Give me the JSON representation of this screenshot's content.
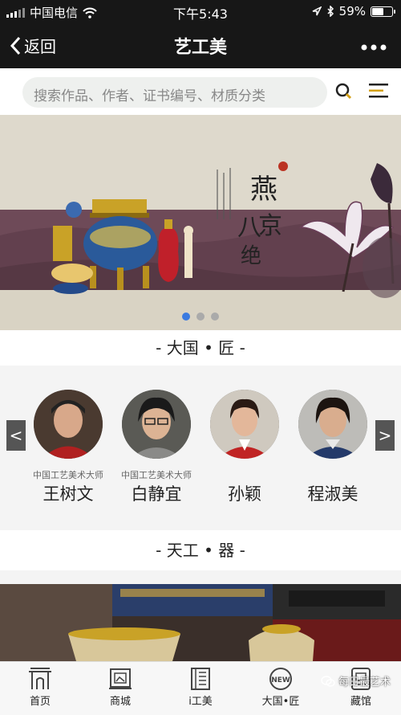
{
  "status": {
    "carrier": "中国电信",
    "time": "下午5:43",
    "battery": "59%",
    "battery_fraction": 0.59
  },
  "nav": {
    "back": "返回",
    "title": "艺工美"
  },
  "search": {
    "placeholder": "搜索作品、作者、证书编号、材质分类"
  },
  "banner": {
    "calligraphy": "燕京八绝",
    "slides": 3,
    "active_slide": 1
  },
  "sections": {
    "first": "- 大国 • 匠 -",
    "second": "- 天工 • 器 -"
  },
  "artists": [
    {
      "role": "中国工艺美术大师",
      "name": "王树文"
    },
    {
      "role": "中国工艺美术大师",
      "name": "白静宜"
    },
    {
      "role": "",
      "name": "孙颖"
    },
    {
      "role": "",
      "name": "程淑美"
    }
  ],
  "arrows": {
    "prev": "<",
    "next": ">"
  },
  "tabs": [
    {
      "label": "首页",
      "icon": "home-gate-icon"
    },
    {
      "label": "商城",
      "icon": "painting-frame-icon"
    },
    {
      "label": "i工美",
      "icon": "book-icon"
    },
    {
      "label": "大国•匠",
      "icon": "new-badge-icon",
      "badge": "NEW"
    },
    {
      "label": "藏馆",
      "icon": "cabinet-icon"
    }
  ],
  "watermark": "每日最艺术"
}
